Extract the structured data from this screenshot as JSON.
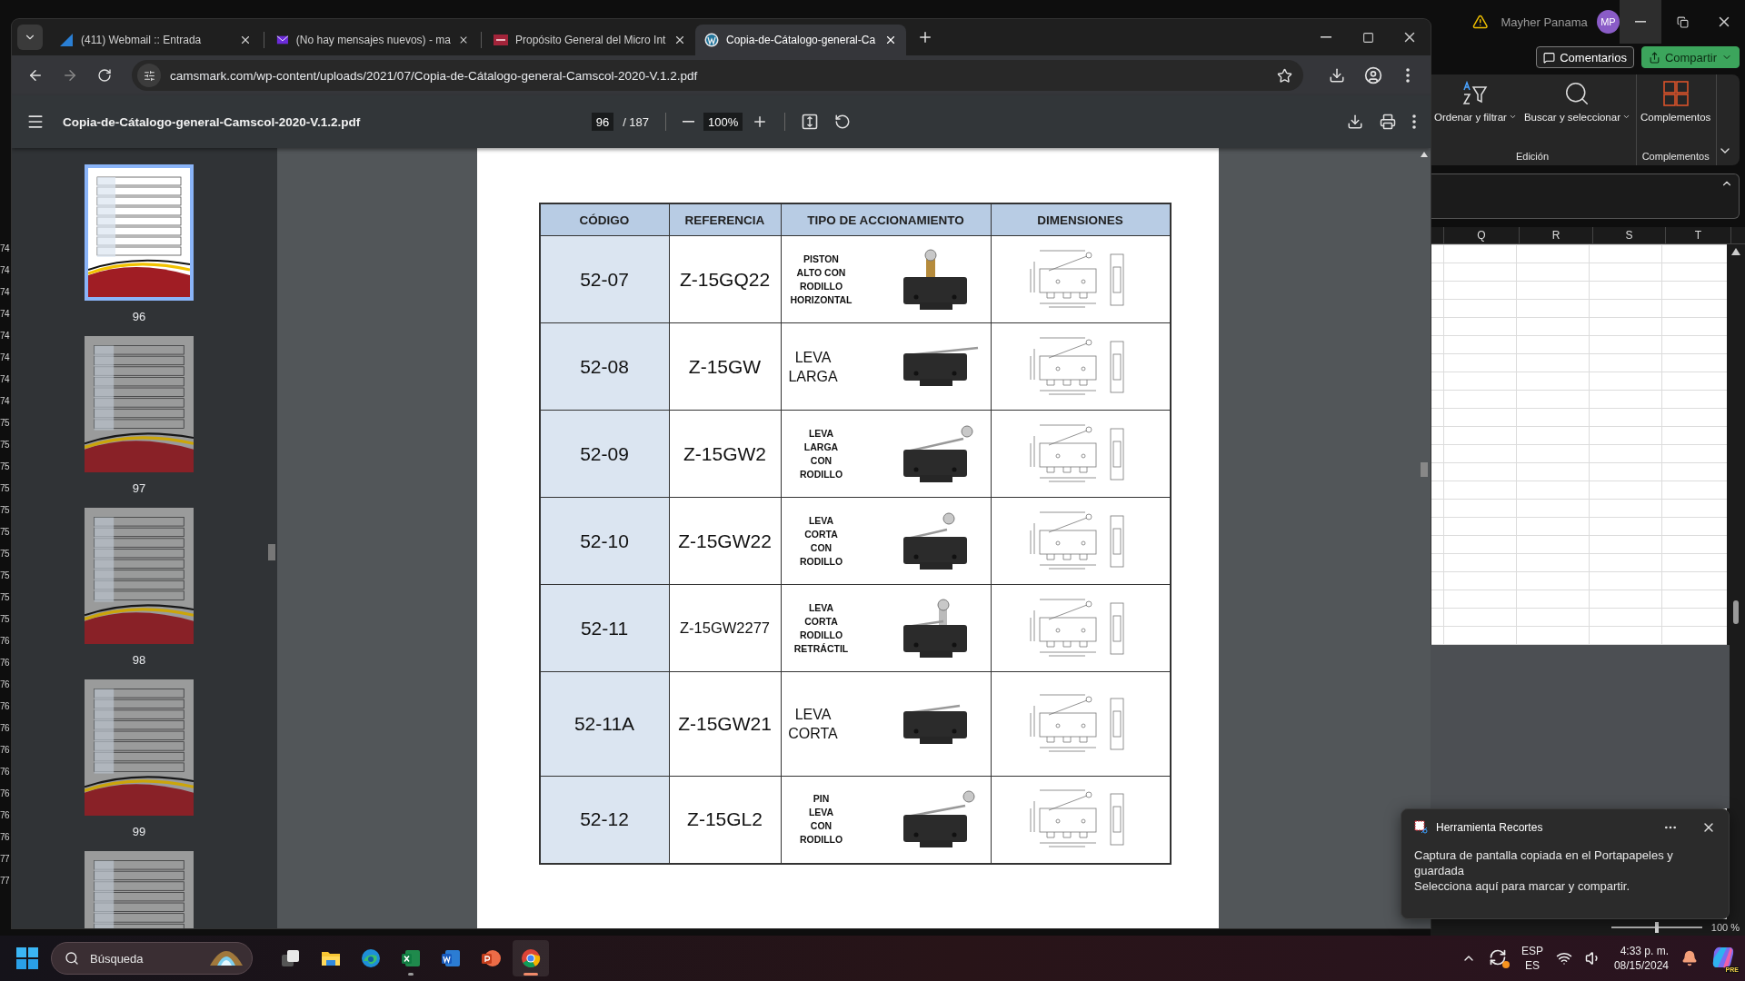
{
  "excel": {
    "user": "Mayher Panama",
    "avatar": "MP",
    "buttons": [
      {
        "kind": "comments",
        "label": "Comentarios"
      },
      {
        "kind": "share",
        "label": "Compartir"
      }
    ],
    "ribbon": {
      "groups": [
        {
          "label": "Edición",
          "items": [
            {
              "kind": "sort-filter",
              "label": "Ordenar y filtrar",
              "dropdown": true
            },
            {
              "kind": "find",
              "label": "Buscar y seleccionar",
              "dropdown": true
            }
          ]
        },
        {
          "label": "Complementos",
          "items": [
            {
              "kind": "addins",
              "label": "Complementos",
              "dropdown": false
            }
          ]
        }
      ]
    },
    "columns": [
      "Q",
      "R",
      "S",
      "T"
    ],
    "row_numbers": [
      "74",
      "74",
      "74",
      "74",
      "74",
      "74",
      "74",
      "74",
      "75",
      "75",
      "75",
      "75",
      "75",
      "75",
      "75",
      "75",
      "75",
      "75",
      "76",
      "76",
      "76",
      "76",
      "76",
      "76",
      "76",
      "76",
      "76",
      "76",
      "77",
      "77"
    ],
    "zoom_slider": {
      "level": 0.5
    },
    "zoom": "100 %"
  },
  "browser": {
    "tabs": [
      {
        "title": "(411) Webmail :: Entrada",
        "kind": "webmail",
        "selected": false
      },
      {
        "title": "(No hay mensajes nuevos) - ma",
        "kind": "mail",
        "selected": false
      },
      {
        "title": "Propósito General del Micro Int",
        "kind": "document",
        "selected": false
      },
      {
        "title": "Copia-de-Cátalogo-general-Ca",
        "kind": "blog",
        "selected": true
      }
    ],
    "url": "camsmark.com/wp-content/uploads/2021/07/Copia-de-Cátalogo-general-Camscol-2020-V.1.2.pdf",
    "pdf": {
      "title": "Copia-de-Cátalogo-general-Camscol-2020-V.1.2.pdf",
      "page": "96",
      "page_count": "/ 187",
      "zoom": "100%",
      "thumbnails": [
        {
          "page": "96",
          "selected": true
        },
        {
          "page": "97",
          "selected": false
        },
        {
          "page": "98",
          "selected": false
        },
        {
          "page": "99",
          "selected": false
        }
      ],
      "table": {
        "columns": [
          "CÓDIGO",
          "REFERENCIA",
          "TIPO DE ACCIONAMIENTO",
          "DIMENSIONES"
        ],
        "rows": [
          {
            "code": "52-07",
            "reference": "Z-15GQ22",
            "actuation": [
              "PISTON",
              "ALTO CON",
              "RODILLO",
              "HORIZONTAL"
            ],
            "kind": "piston"
          },
          {
            "code": "52-08",
            "reference": "Z-15GW",
            "actuation": [
              "LEVA",
              "LARGA"
            ],
            "kind": "long-lever"
          },
          {
            "code": "52-09",
            "reference": "Z-15GW2",
            "actuation": [
              "LEVA",
              "LARGA",
              "CON",
              "RODILLO"
            ],
            "kind": "long-lever-roller"
          },
          {
            "code": "52-10",
            "reference": "Z-15GW22",
            "actuation": [
              "LEVA",
              "CORTA",
              "CON",
              "RODILLO"
            ],
            "kind": "short-lever-roller"
          },
          {
            "code": "52-11",
            "reference": "Z-15GW2277",
            "actuation": [
              "LEVA",
              "CORTA",
              "RODILLO",
              "RETRÁCTIL"
            ],
            "kind": "upright-roller"
          },
          {
            "code": "52-11A",
            "reference": "Z-15GW21",
            "actuation": [
              "LEVA",
              "CORTA"
            ],
            "kind": "short-lever"
          },
          {
            "code": "52-12",
            "reference": "Z-15GL2",
            "actuation": [
              "PIN",
              "LEVA",
              "CON",
              "RODILLO"
            ],
            "kind": "pin-roller"
          }
        ]
      }
    }
  },
  "notification": {
    "app": "Herramienta Recortes",
    "message": "Captura de pantalla copiada en el Portapapeles y guardada",
    "hint": "Selecciona aquí para marcar y compartir."
  },
  "taskbar": {
    "search": {
      "placeholder": "Búsqueda"
    },
    "apps": [
      {
        "kind": "task-view",
        "selected": false,
        "running": false
      },
      {
        "kind": "files",
        "selected": false,
        "running": false
      },
      {
        "kind": "edge",
        "selected": false,
        "running": false
      },
      {
        "kind": "excel",
        "selected": false,
        "running": true
      },
      {
        "kind": "word",
        "selected": false,
        "running": false
      },
      {
        "kind": "powerpoint",
        "selected": false,
        "running": false
      },
      {
        "kind": "chrome",
        "selected": true,
        "running": true
      }
    ],
    "language": "ESP",
    "region": "ES",
    "time": "4:33 p. m.",
    "date": "08/15/2024",
    "copilot_badge": "PRE"
  }
}
